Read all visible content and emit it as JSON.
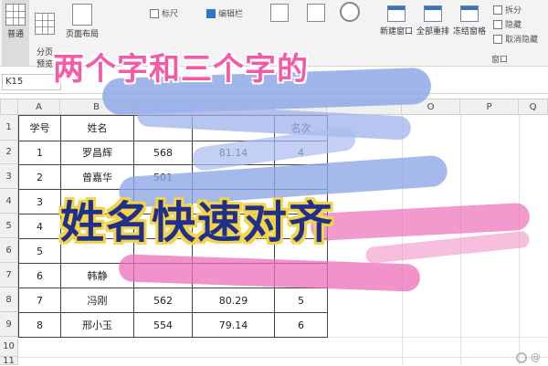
{
  "ribbon": {
    "buttons": [
      {
        "key": "normal",
        "label": "普通"
      },
      {
        "key": "page_break",
        "label": "分页\n预览"
      },
      {
        "key": "page_layout",
        "label": "页面布局"
      },
      {
        "key": "new_window",
        "label": "新建窗口"
      },
      {
        "key": "arrange_all",
        "label": "全部重排"
      },
      {
        "key": "freeze",
        "label": "冻结窗格"
      }
    ],
    "checks": [
      {
        "label": "标尺",
        "checked": false
      },
      {
        "label": "编辑栏",
        "checked": true
      }
    ],
    "window_small": [
      {
        "label": "拆分"
      },
      {
        "label": "隐藏"
      },
      {
        "label": "取消隐藏"
      }
    ],
    "group_window_label": "窗口"
  },
  "name_box": "K15",
  "columns": [
    "A",
    "B",
    "",
    "",
    "",
    "",
    "",
    "O",
    "P",
    "Q"
  ],
  "rows": [
    "1",
    "2",
    "3",
    "4",
    "5",
    "6",
    "7",
    "8",
    "9",
    "10",
    "11"
  ],
  "table": {
    "header": [
      "学号",
      "姓名",
      "",
      "",
      "名次"
    ],
    "rows": [
      [
        "1",
        "罗昌辉",
        "568",
        "81.14",
        "4"
      ],
      [
        "2",
        "曾嘉华",
        "501",
        "",
        ""
      ],
      [
        "3",
        "",
        "",
        "",
        ""
      ],
      [
        "4",
        "",
        "",
        "",
        ""
      ],
      [
        "5",
        "",
        "",
        "",
        ""
      ],
      [
        "6",
        "韩静",
        "",
        "",
        ""
      ],
      [
        "7",
        "冯刚",
        "562",
        "80.29",
        "5"
      ],
      [
        "8",
        "邢小玉",
        "554",
        "79.14",
        "6"
      ]
    ]
  },
  "overlay": {
    "title_line": "两个字和三个字的",
    "main_line": "姓名快速对齐"
  },
  "watermark": "@",
  "colors": {
    "pink_text": "#f55aa6",
    "navy_text": "#1f2f8a",
    "yellow_outline": "#f3d34a",
    "blue_stroke": "#8fa8e6",
    "pink_stroke": "#ec6fb8"
  }
}
